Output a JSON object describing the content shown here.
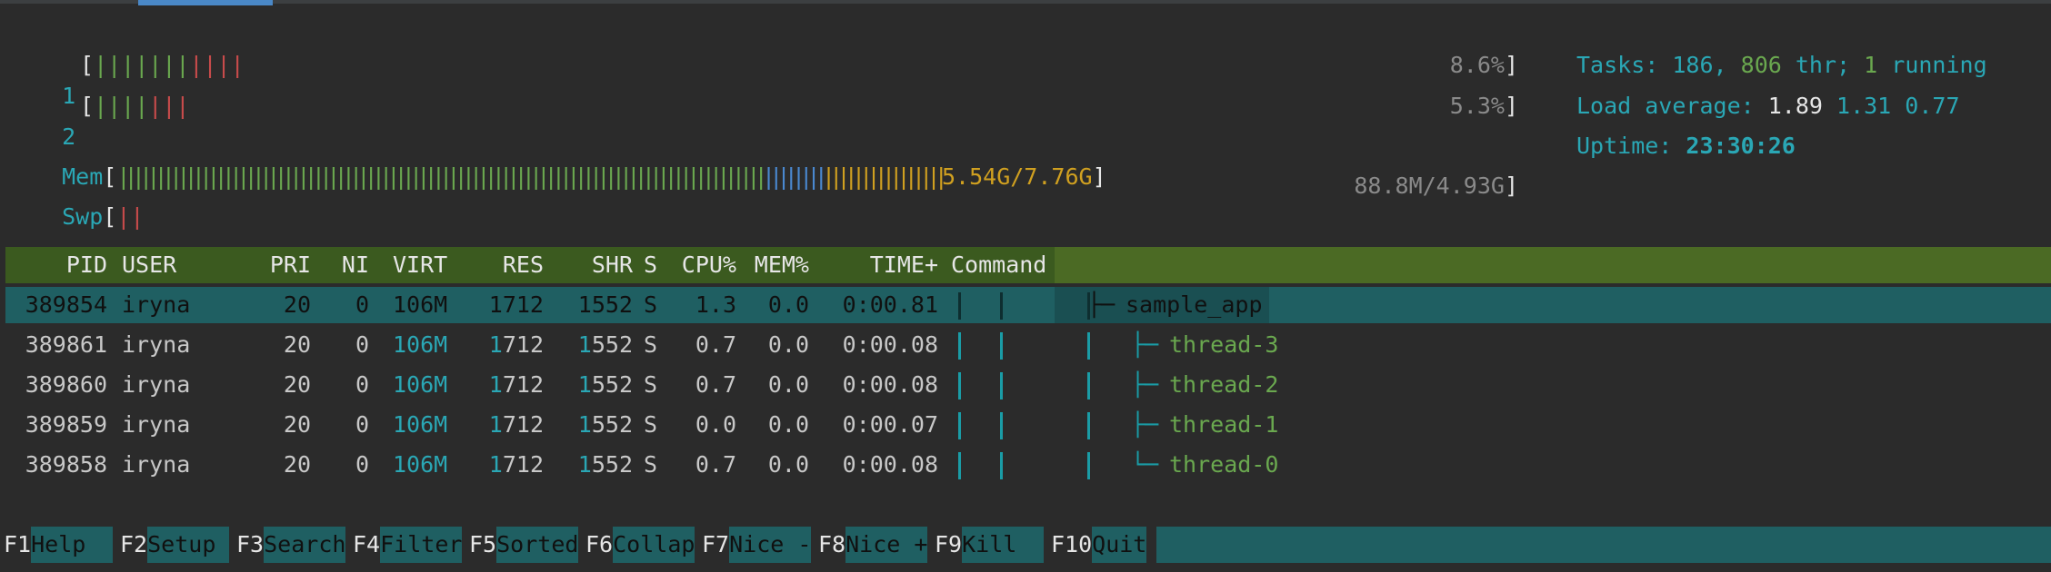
{
  "meters": {
    "cpu1": {
      "label": "1",
      "value": "8.6%",
      "bar_green": "|||||||",
      "bar_red": "||||"
    },
    "cpu2": {
      "label": "2",
      "value": "5.3%",
      "bar_green": "||||",
      "bar_red": "|||"
    },
    "mem": {
      "label": "Mem",
      "value": "5.54G/7.76G",
      "bar_green": "||||||||||||||||||||||||||||||||||||||||||||||||||||||||||||||||||||||||||||||||||||||",
      "bar_blue": "||||||||",
      "bar_orange": "||||||||||||||||"
    },
    "swp": {
      "label": "Swp",
      "value": "88.8M/4.93G",
      "bar_red": "||"
    }
  },
  "stats": {
    "tasks_label": "Tasks:",
    "tasks_count": "186,",
    "threads": "806",
    "thr_label": "thr;",
    "running_count": "1",
    "running_label": "running",
    "load_label": "Load average:",
    "load1": "1.89",
    "load5": "1.31",
    "load15": "0.77",
    "uptime_label": "Uptime:",
    "uptime": "23:30:26"
  },
  "columns": [
    "PID",
    "USER",
    "PRI",
    "NI",
    "VIRT",
    "RES",
    "SHR",
    "S",
    "CPU%",
    "MEM%",
    "TIME+",
    "Command"
  ],
  "processes": [
    {
      "pid": "389854",
      "user": "iryna",
      "pri": "20",
      "ni": "0",
      "virt": "106M",
      "res": "1712",
      "shr": "1552",
      "s": "S",
      "cpu": "1.3",
      "mem": "0.0",
      "time": "0:00.81",
      "cmd": "sample_app",
      "branch": "├─"
    },
    {
      "pid": "389861",
      "user": "iryna",
      "pri": "20",
      "ni": "0",
      "virt": "106M",
      "res": "1712",
      "shr": "1552",
      "s": "S",
      "cpu": "0.7",
      "mem": "0.0",
      "time": "0:00.08",
      "cmd": "thread-3",
      "branch": "├─"
    },
    {
      "pid": "389860",
      "user": "iryna",
      "pri": "20",
      "ni": "0",
      "virt": "106M",
      "res": "1712",
      "shr": "1552",
      "s": "S",
      "cpu": "0.7",
      "mem": "0.0",
      "time": "0:00.08",
      "cmd": "thread-2",
      "branch": "├─"
    },
    {
      "pid": "389859",
      "user": "iryna",
      "pri": "20",
      "ni": "0",
      "virt": "106M",
      "res": "1712",
      "shr": "1552",
      "s": "S",
      "cpu": "0.0",
      "mem": "0.0",
      "time": "0:00.07",
      "cmd": "thread-1",
      "branch": "├─"
    },
    {
      "pid": "389858",
      "user": "iryna",
      "pri": "20",
      "ni": "0",
      "virt": "106M",
      "res": "1712",
      "shr": "1552",
      "s": "S",
      "cpu": "0.7",
      "mem": "0.0",
      "time": "0:00.08",
      "cmd": "thread-0",
      "branch": "└─"
    }
  ],
  "fkeys": [
    {
      "key": "F1",
      "label": "Help  "
    },
    {
      "key": "F2",
      "label": "Setup "
    },
    {
      "key": "F3",
      "label": "Search"
    },
    {
      "key": "F4",
      "label": "Filter"
    },
    {
      "key": "F5",
      "label": "Sorted"
    },
    {
      "key": "F6",
      "label": "Collap"
    },
    {
      "key": "F7",
      "label": "Nice -"
    },
    {
      "key": "F8",
      "label": "Nice +"
    },
    {
      "key": "F9",
      "label": "Kill  "
    },
    {
      "key": "F10",
      "label": "Quit"
    }
  ],
  "colors": {
    "accent": "#2aa7b5",
    "header_bg": "#3b5a1f",
    "selected_bg": "#1f5f62",
    "tree_line": "#1a9ca6"
  }
}
